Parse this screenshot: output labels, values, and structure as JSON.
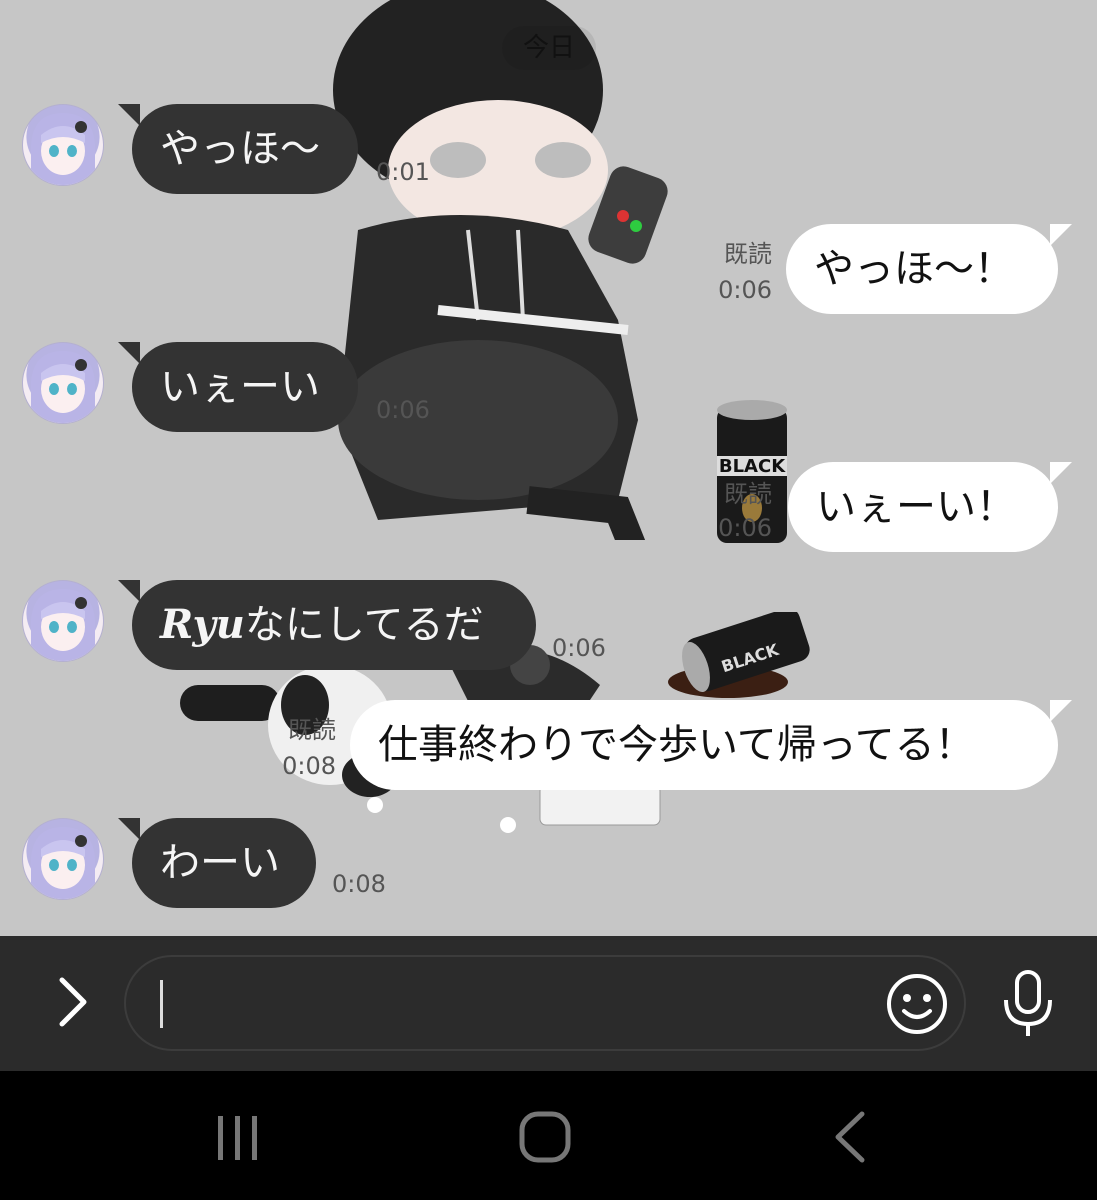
{
  "chat": {
    "date_label": "今日",
    "messages": [
      {
        "side": "in",
        "text": "やっほ〜",
        "time": "0:01",
        "read": ""
      },
      {
        "side": "out",
        "text": "やっほ〜！",
        "time": "0:06",
        "read": "既読"
      },
      {
        "side": "in",
        "text": "いぇーい",
        "time": "0:06",
        "read": ""
      },
      {
        "side": "out",
        "text": "いぇーい！",
        "time": "0:06",
        "read": "既読"
      },
      {
        "side": "in",
        "text_prefix": "Ryu",
        "text": "なにしてるだ",
        "time": "0:06",
        "read": ""
      },
      {
        "side": "out",
        "text": "仕事終わりで今歩いて帰ってる！",
        "time": "0:08",
        "read": "既読"
      },
      {
        "side": "in",
        "text": "わーい",
        "time": "0:08",
        "read": ""
      }
    ]
  },
  "input": {
    "placeholder": "",
    "value": ""
  },
  "icons": {
    "expand": "chevron-right-icon",
    "emoji": "smiley-icon",
    "mic": "microphone-icon",
    "nav_recent": "recent-apps-icon",
    "nav_home": "home-icon",
    "nav_back": "back-icon"
  },
  "colors": {
    "chat_background": "#c6c6c6",
    "incoming_bubble": "#333333",
    "outgoing_bubble": "#ffffff",
    "input_bar": "#2b2b2b",
    "nav_bar": "#000000"
  }
}
